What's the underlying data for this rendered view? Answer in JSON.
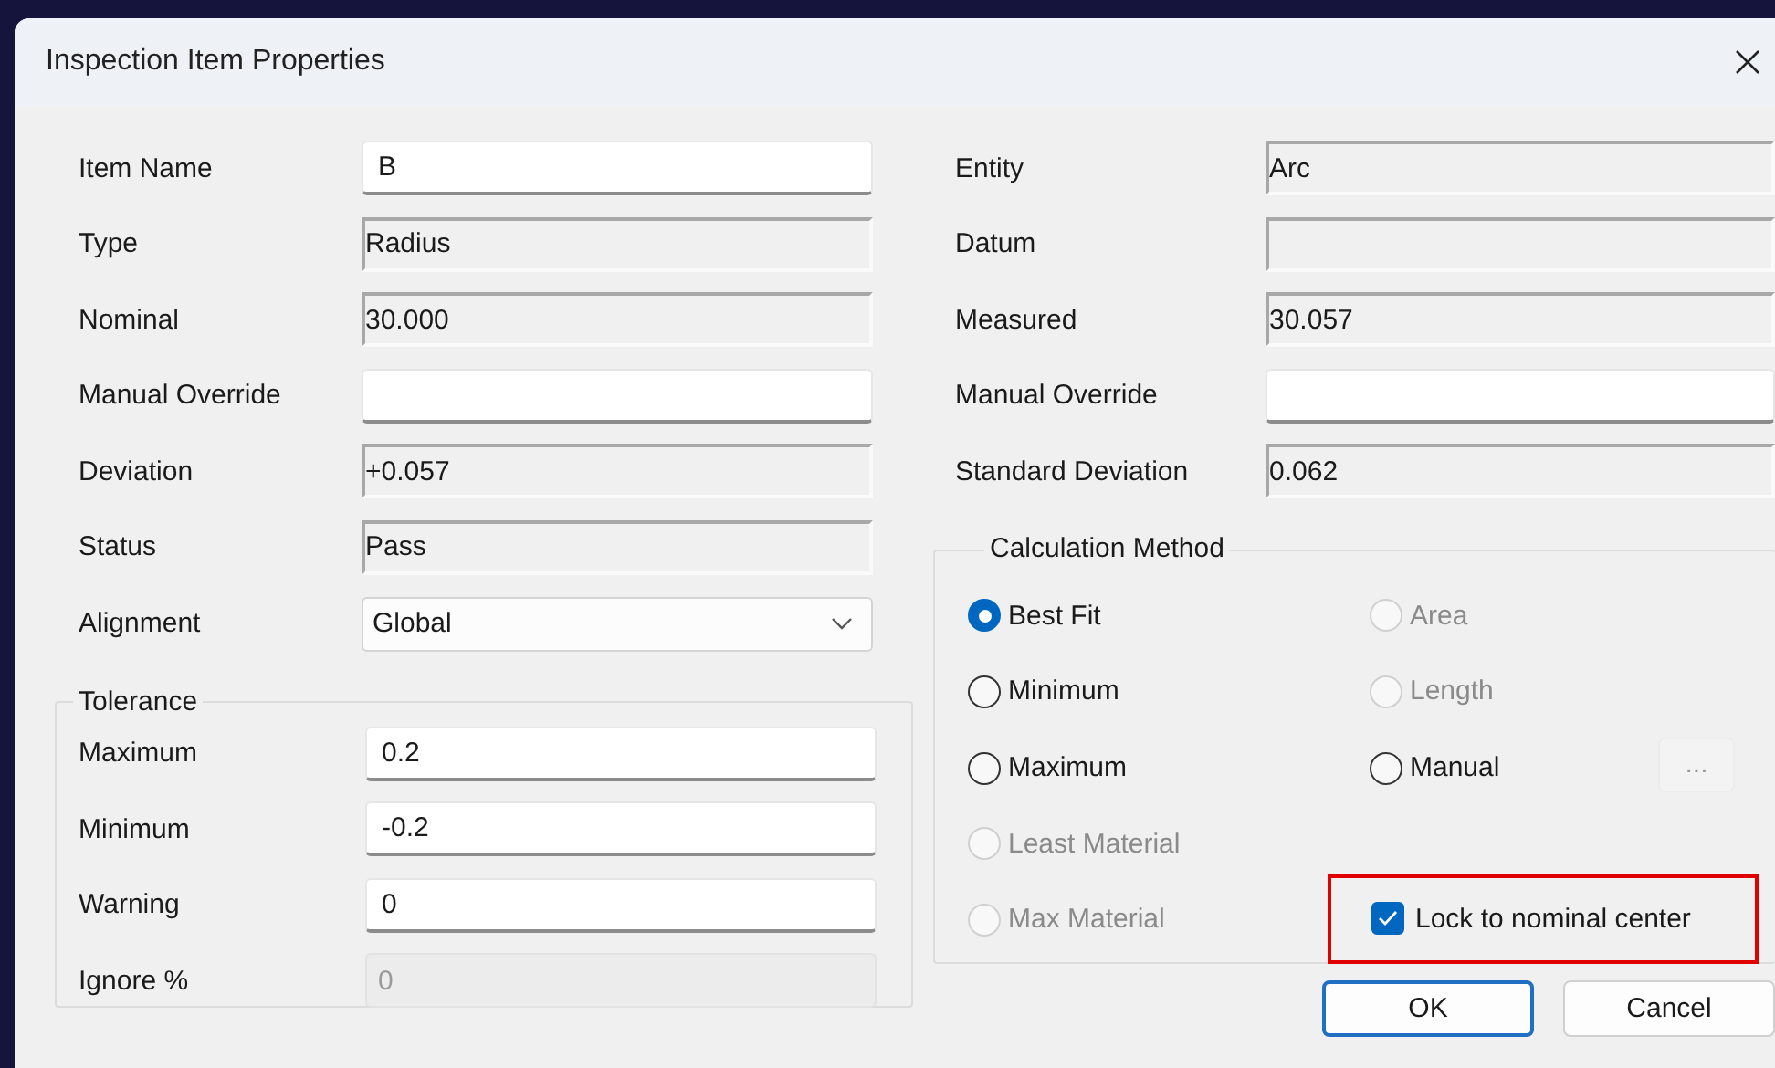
{
  "window": {
    "title": "Inspection Item Properties"
  },
  "left_fields": [
    {
      "label": "Item Name",
      "kind": "edit",
      "value": "B"
    },
    {
      "label": "Type",
      "kind": "readonly",
      "value": "Radius"
    },
    {
      "label": "Nominal",
      "kind": "readonly",
      "value": "30.000"
    },
    {
      "label": "Manual Override",
      "kind": "edit"
    },
    {
      "label": "Deviation",
      "kind": "readonly",
      "value": "+0.057"
    },
    {
      "label": "Status",
      "kind": "readonly",
      "value": "Pass"
    },
    {
      "label": "Alignment",
      "kind": "dropdown",
      "value": "Global"
    }
  ],
  "tolerance": {
    "title": "Tolerance",
    "fields": [
      {
        "label": "Maximum",
        "kind": "edit",
        "value": "0.2"
      },
      {
        "label": "Minimum",
        "kind": "edit",
        "value": "-0.2"
      },
      {
        "label": "Warning",
        "kind": "edit",
        "value": "0"
      },
      {
        "label": "Ignore %",
        "kind": "disabled",
        "value": "0"
      }
    ]
  },
  "right_fields": [
    {
      "label": "Entity",
      "kind": "readonly",
      "value": "Arc"
    },
    {
      "label": "Datum",
      "kind": "readonly"
    },
    {
      "label": "Measured",
      "kind": "readonly",
      "value": "30.057"
    },
    {
      "label": "Manual Override",
      "kind": "edit"
    },
    {
      "label": "Standard Deviation",
      "kind": "readonly",
      "value": "0.062"
    }
  ],
  "calculation_method": {
    "title": "Calculation Method",
    "rows": [
      {
        "options": [
          {
            "label": "Best Fit",
            "selected": true,
            "disabled": false
          },
          {
            "label": "Area",
            "selected": false,
            "disabled": true
          }
        ]
      },
      {
        "options": [
          {
            "label": "Minimum",
            "selected": false,
            "disabled": false
          },
          {
            "label": "Length",
            "selected": false,
            "disabled": true
          }
        ]
      },
      {
        "options": [
          {
            "label": "Maximum",
            "selected": false,
            "disabled": false
          },
          {
            "label": "Manual",
            "selected": false,
            "disabled": false
          }
        ],
        "button": {
          "label": "...",
          "disabled": true
        }
      },
      {
        "options": [
          {
            "label": "Least Material",
            "selected": false,
            "disabled": true
          }
        ]
      },
      {
        "options": [
          {
            "label": "Max Material",
            "selected": false,
            "disabled": true
          }
        ],
        "checkbox": {
          "label": "Lock to nominal center",
          "checked": true,
          "highlighted": true
        }
      }
    ]
  },
  "buttons": [
    {
      "label": "OK",
      "default": true
    },
    {
      "label": "Cancel",
      "default": false
    }
  ]
}
